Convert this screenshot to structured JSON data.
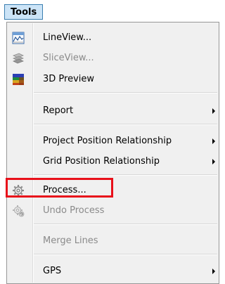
{
  "menubar": {
    "tools_label": "Tools"
  },
  "menu": {
    "items": [
      {
        "label": "LineView...",
        "icon": "lineview-icon",
        "enabled": true
      },
      {
        "label": "SliceView...",
        "icon": "sliceview-icon",
        "enabled": false
      },
      {
        "label": "3D Preview",
        "icon": "3d-preview-icon",
        "enabled": true
      },
      {
        "label": "Report",
        "enabled": true,
        "submenu": true
      },
      {
        "label": "Project Position Relationship",
        "enabled": true,
        "submenu": true
      },
      {
        "label": "Grid Position Relationship",
        "enabled": true,
        "submenu": true
      },
      {
        "label": "Process...",
        "icon": "gear-icon",
        "enabled": true
      },
      {
        "label": "Undo Process",
        "icon": "undo-gear-icon",
        "enabled": false
      },
      {
        "label": "Merge Lines",
        "enabled": false
      },
      {
        "label": "GPS",
        "enabled": true,
        "submenu": true
      }
    ]
  },
  "colors": {
    "highlight_box": "#e8101a",
    "menu_background": "#f0f0f0",
    "title_highlight": "#cce4f7"
  }
}
